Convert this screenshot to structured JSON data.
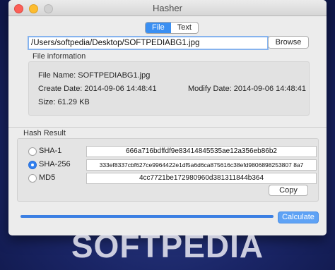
{
  "window": {
    "title": "Hasher"
  },
  "mode_tabs": [
    {
      "label": "File",
      "active": true
    },
    {
      "label": "Text",
      "active": false
    }
  ],
  "file_path": {
    "value": "/Users/softpedia/Desktop/SOFTPEDIABG1.jpg"
  },
  "browse_label": "Browse",
  "file_info": {
    "heading": "File information",
    "name": "File Name: SOFTPEDIABG1.jpg",
    "create_date": "Create Date: 2014-09-06 14:48:41",
    "modify_date": "Modify Date: 2014-09-06 14:48:41",
    "size": "Size: 61.29 KB"
  },
  "hash_result": {
    "heading": "Hash Result",
    "rows": [
      {
        "algorithm": "SHA-1",
        "value": "666a716bdffdf9e83414845535ae12a356eb86b2",
        "selected": false
      },
      {
        "algorithm": "SHA-256",
        "value": "333ef8337cbf627ce9964422e1df5a6d6ca875616c38efd9806898253807 8a7",
        "selected": true
      },
      {
        "algorithm": "MD5",
        "value": "4cc7721be172980960d381311844b364",
        "selected": false
      }
    ],
    "copy_label": "Copy"
  },
  "progress": {
    "value": 1.0
  },
  "calculate_label": "Calculate",
  "watermark": "SOFTPEDIA",
  "colors": {
    "accent": "#3a8ff2",
    "background": "#1a2566"
  }
}
